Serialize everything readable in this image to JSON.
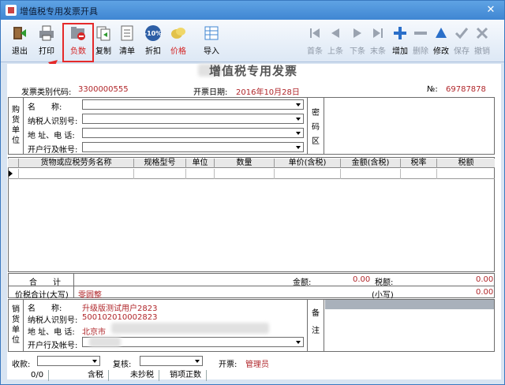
{
  "window": {
    "title": "增值税专用发票开具"
  },
  "toolbar": {
    "exit": "退出",
    "print": "打印",
    "negative": "负数",
    "copy": "复制",
    "list": "清单",
    "discount": "折扣",
    "price": "价格",
    "import": "导入",
    "first": "首条",
    "prev": "上条",
    "next": "下条",
    "last": "末条",
    "add": "增加",
    "delete": "删除",
    "modify": "修改",
    "save": "保存",
    "cancel": "撤销",
    "discount_badge": "-10%"
  },
  "invoice": {
    "title": "增值税专用发票",
    "code_label": "发票类别代码:",
    "code": "3300000555",
    "date_label": "开票日期:",
    "date": "2016年10月28日",
    "no_label": "№:",
    "no": "69787878"
  },
  "buyer": {
    "section_label": [
      "购",
      "货",
      "单",
      "位"
    ],
    "name_label": "名　　称:",
    "taxid_label": "纳税人识别号:",
    "address_label": "地 址、电 话:",
    "bank_label": "开户行及帐号:",
    "password_label": [
      "密",
      "码",
      "区"
    ]
  },
  "grid": {
    "columns": [
      "货物或应税劳务名称",
      "规格型号",
      "单位",
      "数量",
      "单价(含税)",
      "金额(含税)",
      "税率",
      "税额"
    ]
  },
  "totals": {
    "sum_label": "合　　计",
    "amount_label": "金额:",
    "amount_value": "0.00",
    "tax_label": "税额:",
    "tax_value": "0.00",
    "grand_label": "价税合计(大写)",
    "grand_value": "零圆整",
    "small_label": "(小写)",
    "small_value": "0.00"
  },
  "seller": {
    "section_label": [
      "销",
      "货",
      "单",
      "位"
    ],
    "name_label": "名　　称:",
    "name_value": "升级版测试用户2823",
    "taxid_label": "纳税人识别号:",
    "taxid_value": "500102010002823",
    "address_label": "地 址、电 话:",
    "address_value": "北京市",
    "bank_label": "开户行及帐号:",
    "remark_label": [
      "备",
      "注"
    ]
  },
  "footer": {
    "payee_label": "收款:",
    "reviewer_label": "复核:",
    "issuer_label": "开票:",
    "issuer_value": "管理员"
  },
  "status": {
    "count": "0/0",
    "mode": "含税",
    "tax": "未抄税",
    "state": "销项正数"
  },
  "colors": {
    "accent": "#3f86d2",
    "highlight": "#e52a2a",
    "red_text": "#b0262a"
  }
}
